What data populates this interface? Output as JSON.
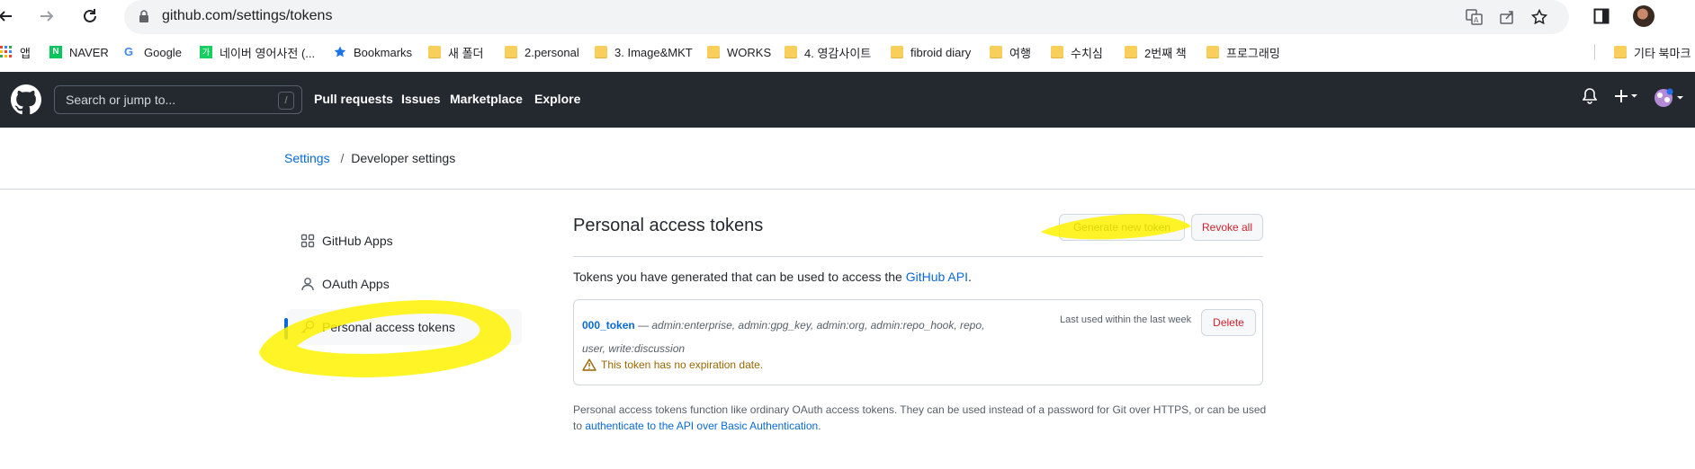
{
  "browser": {
    "url": "github.com/settings/tokens",
    "bookmarks": [
      {
        "label": "앱",
        "icon": "apps-grid-icon"
      },
      {
        "label": "NAVER",
        "icon": "naver-icon"
      },
      {
        "label": "Google",
        "icon": "google-icon"
      },
      {
        "label": "네이버 영어사전 (...",
        "icon": "naver-dict-icon"
      },
      {
        "label": "Bookmarks",
        "icon": "star-icon"
      },
      {
        "label": "새 폴더",
        "icon": "folder-icon"
      },
      {
        "label": "2.personal",
        "icon": "folder-icon"
      },
      {
        "label": "3. Image&MKT",
        "icon": "folder-icon"
      },
      {
        "label": "WORKS",
        "icon": "folder-icon"
      },
      {
        "label": "4. 영감사이트",
        "icon": "folder-icon"
      },
      {
        "label": "fibroid diary",
        "icon": "folder-icon"
      },
      {
        "label": "여행",
        "icon": "folder-icon"
      },
      {
        "label": "수치심",
        "icon": "folder-icon"
      },
      {
        "label": "2번째 책",
        "icon": "folder-icon"
      },
      {
        "label": "프로그래밍",
        "icon": "folder-icon"
      },
      {
        "label": "기타 북마크",
        "icon": "folder-icon"
      }
    ]
  },
  "github": {
    "search_placeholder": "Search or jump to...",
    "search_shortcut": "/",
    "nav": [
      "Pull requests",
      "Issues",
      "Marketplace",
      "Explore"
    ]
  },
  "breadcrumb": {
    "settings": "Settings",
    "separator": "/",
    "current": "Developer settings"
  },
  "sidebar": {
    "items": [
      {
        "label": "GitHub Apps",
        "icon": "apps-icon",
        "active": false
      },
      {
        "label": "OAuth Apps",
        "icon": "person-icon",
        "active": false
      },
      {
        "label": "Personal access tokens",
        "icon": "key-icon",
        "active": true
      }
    ]
  },
  "main": {
    "title": "Personal access tokens",
    "generate_label": "Generate new token",
    "revoke_label": "Revoke all",
    "intro_text": "Tokens you have generated that can be used to access the ",
    "intro_link": "GitHub API",
    "intro_end": ".",
    "token": {
      "name": "000_token",
      "dash": " — ",
      "scopes": "admin:enterprise, admin:gpg_key, admin:org, admin:repo_hook, repo, user, write:discussion",
      "last_used": "Last used within the last week",
      "delete_label": "Delete",
      "warning": "This token has no expiration date."
    },
    "footer_text": "Personal access tokens function like ordinary OAuth access tokens. They can be used instead of a password for Git over HTTPS, or can be used to ",
    "footer_link": "authenticate to the API over Basic Authentication",
    "footer_end": "."
  },
  "colors": {
    "header_bg": "#24292f",
    "link": "#0969da",
    "danger": "#cf222e",
    "warning": "#9a6700",
    "highlighter": "#fff200"
  }
}
